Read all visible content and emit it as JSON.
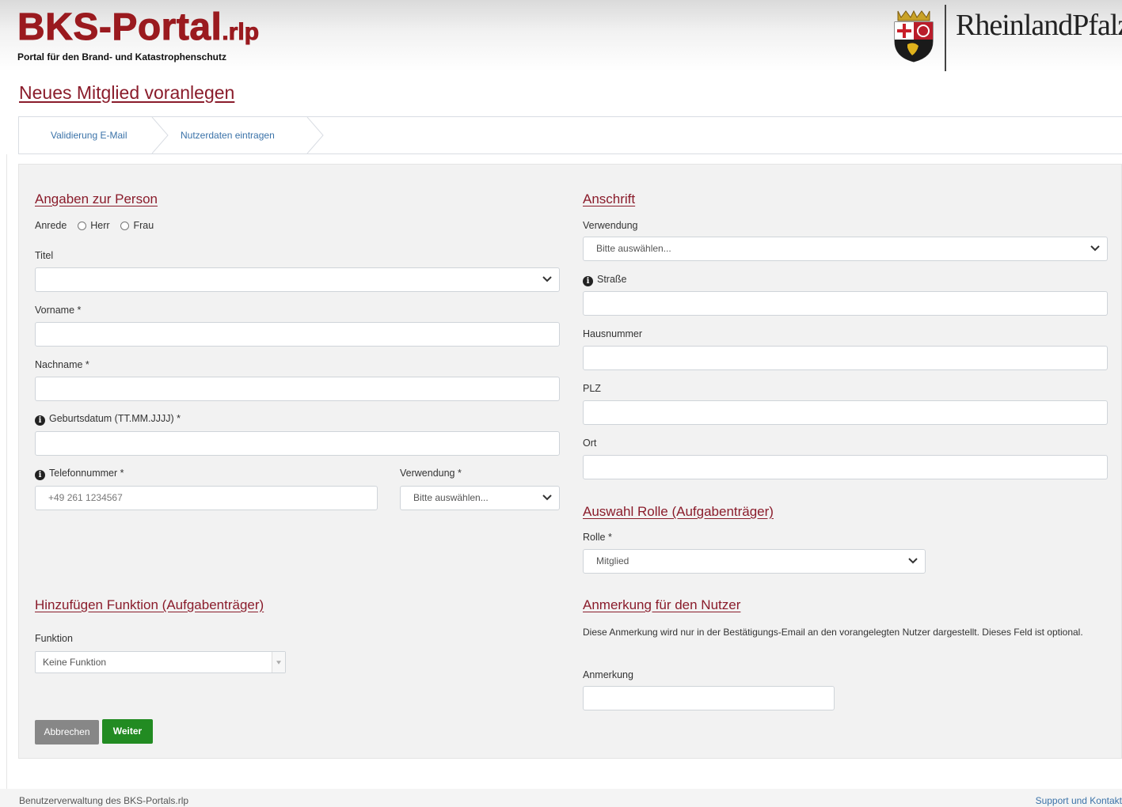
{
  "header": {
    "brand_title": "BKS-Portal",
    "brand_suffix": ".rlp",
    "brand_subtitle": "Portal für den Brand- und Katastrophenschutz",
    "state_logo_text": "RheinlandPfalz"
  },
  "page_title": "Neues Mitglied voranlegen",
  "steps": [
    "Validierung E-Mail",
    "Nutzerdaten eintragen"
  ],
  "person": {
    "heading": "Angaben zur Person",
    "anrede_label": "Anrede",
    "anrede_options": [
      "Herr",
      "Frau"
    ],
    "titel_label": "Titel",
    "titel_value": "",
    "vorname_label": "Vorname *",
    "nachname_label": "Nachname *",
    "geburtsdatum_label": "Geburtsdatum (TT.MM.JJJJ) *",
    "telefon_label": "Telefonnummer *",
    "telefon_placeholder": "+49 261 1234567",
    "verwendung_label": "Verwendung *",
    "verwendung_value": "Bitte auswählen..."
  },
  "address": {
    "heading": "Anschrift",
    "verwendung_label": "Verwendung",
    "verwendung_value": "Bitte auswählen...",
    "strasse_label": "Straße",
    "hausnummer_label": "Hausnummer",
    "plz_label": "PLZ",
    "ort_label": "Ort"
  },
  "role": {
    "heading": "Auswahl Rolle (Aufgabenträger)",
    "label": "Rolle *",
    "value": "Mitglied"
  },
  "function": {
    "heading": "Hinzufügen Funktion (Aufgabenträger)",
    "label": "Funktion",
    "value": "Keine Funktion"
  },
  "remark": {
    "heading": "Anmerkung für den Nutzer",
    "description": "Diese Anmerkung wird nur in der Bestätigungs-Email an den vorangelegten Nutzer dargestellt. Dieses Feld ist optional.",
    "label": "Anmerkung"
  },
  "buttons": {
    "cancel": "Abbrechen",
    "next": "Weiter"
  },
  "footer": {
    "left": "Benutzerverwaltung des BKS-Portals.rlp",
    "right": "Support und Kontakt"
  },
  "colors": {
    "brand_red": "#9a1a1f",
    "heading_red": "#8a1c2b",
    "link_blue": "#3a72a8",
    "next_green": "#228b22",
    "cancel_gray": "#878787"
  }
}
